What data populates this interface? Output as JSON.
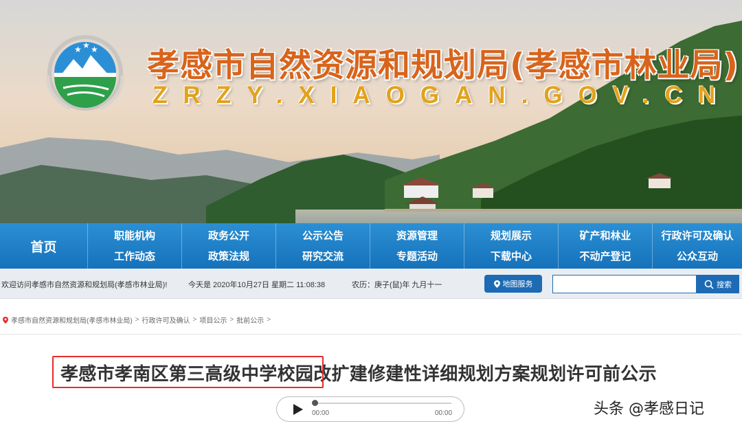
{
  "header": {
    "title": "孝感市自然资源和规划局(孝感市林业局)",
    "domain": "ZRZY.XIAOGAN.GOV.CN"
  },
  "nav": {
    "home": "首页",
    "columns": [
      [
        "职能机构",
        "工作动态"
      ],
      [
        "政务公开",
        "政策法规"
      ],
      [
        "公示公告",
        "研究交流"
      ],
      [
        "资源管理",
        "专题活动"
      ],
      [
        "规划展示",
        "下载中心"
      ],
      [
        "矿产和林业",
        "不动产登记"
      ],
      [
        "行政许可及确认",
        "公众互动"
      ]
    ]
  },
  "infobar": {
    "welcome": "欢迎访问孝感市自然资源和规划局(孝感市林业局)!",
    "date": "今天是 2020年10月27日 星期二 11:08:38",
    "lunar": "农历：庚子(鼠)年 九月十一",
    "map_button": "地图服务",
    "search_placeholder": "",
    "search_button": "搜索"
  },
  "breadcrumb": {
    "items": [
      "孝感市自然资源和规划局(孝感市林业局)",
      "行政许可及确认",
      "项目公示",
      "批前公示"
    ],
    "separator": ">"
  },
  "article": {
    "title": "孝感市孝南区第三高级中学校园改扩建修建性详细规划方案规划许可前公示"
  },
  "player": {
    "current_time": "00:00",
    "duration": "00:00",
    "progress": 0
  },
  "watermark": "头条 @孝感日记",
  "colors": {
    "title": "#d8641c",
    "domain": "#e2a21b",
    "nav_bg": "#1572bb",
    "button_bg": "#1d6bb5",
    "highlight": "#e52b2b"
  },
  "icons": [
    "emblem-logo",
    "location-pin-icon",
    "map-pin-icon",
    "search-icon",
    "play-icon"
  ]
}
